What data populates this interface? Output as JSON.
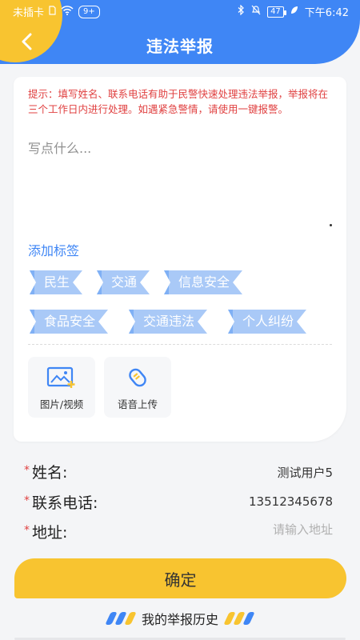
{
  "status_bar": {
    "carrier": "未插卡",
    "notif_badge": "9+",
    "battery": "47",
    "time": "下午6:42"
  },
  "header": {
    "title": "违法举报"
  },
  "card": {
    "tip": "提示：填写姓名、联系电话有助于民警快速处理违法举报，举报将在三个工作日内进行处理。如遇紧急警情，请使用一键报警。",
    "content_placeholder": "写点什么...",
    "add_tags_label": "添加标签",
    "tags": [
      "民生",
      "交通",
      "信息安全",
      "食品安全",
      "交通违法",
      "个人纠纷"
    ],
    "tools": [
      {
        "label": "图片/视频",
        "icon": "image-video-icon"
      },
      {
        "label": "语音上传",
        "icon": "voice-upload-icon"
      }
    ]
  },
  "form": {
    "required_mark": "*",
    "name_label": "姓名:",
    "name_value": "测试用户5",
    "phone_label": "联系电话:",
    "phone_value": "13512345678",
    "address_label": "地址:",
    "address_placeholder": "请输入地址"
  },
  "confirm_label": "确定",
  "history_label": "我的举报历史",
  "colors": {
    "primary_blue": "#3f86f5",
    "accent_yellow": "#f8c430",
    "tip_red": "#e04141",
    "tag_bg": "#a9c9f7"
  }
}
